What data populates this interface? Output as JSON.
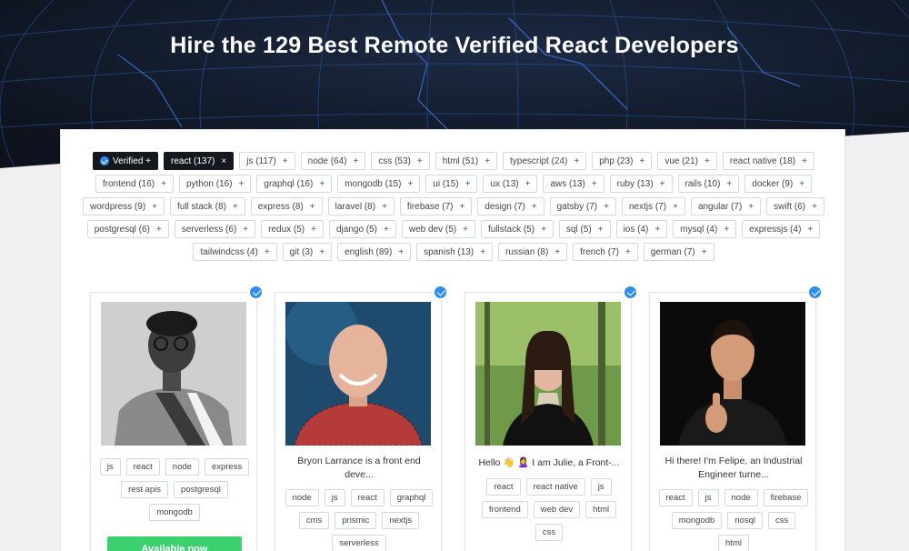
{
  "hero": {
    "title": "Hire the 129 Best Remote Verified React Developers"
  },
  "filters": {
    "verified_label": "Verified +",
    "active_label": "react (137)",
    "active_remove": "×",
    "tag_add_symbol": "+",
    "tags": [
      "js (117)",
      "node (64)",
      "css (53)",
      "html (51)",
      "typescript (24)",
      "php (23)",
      "vue (21)",
      "react native (18)",
      "frontend (16)",
      "python (16)",
      "graphql (16)",
      "mongodb (15)",
      "ui (15)",
      "ux (13)",
      "aws (13)",
      "ruby (13)",
      "rails (10)",
      "docker (9)",
      "wordpress (9)",
      "full stack (8)",
      "express (8)",
      "laravel (8)",
      "firebase (7)",
      "design (7)",
      "gatsby (7)",
      "nextjs (7)",
      "angular (7)",
      "swift (6)",
      "postgresql (6)",
      "serverless (6)",
      "redux (5)",
      "django (5)",
      "web dev (5)",
      "fullstack (5)",
      "sql (5)",
      "ios (4)",
      "mysql (4)",
      "expressjs (4)",
      "tailwindcss (4)",
      "git (3)",
      "english (89)",
      "spanish (13)",
      "russian (8)",
      "french (7)",
      "german (7)"
    ]
  },
  "developers": [
    {
      "bio": "",
      "tags": [
        "js",
        "react",
        "node",
        "express",
        "rest apis",
        "postgresql",
        "mongodb"
      ],
      "cta": "Available now"
    },
    {
      "bio": "Bryon Larrance is a front end deve...",
      "tags": [
        "node",
        "js",
        "react",
        "graphql",
        "cms",
        "prismic",
        "nextjs",
        "serverless"
      ]
    },
    {
      "bio": "Hello 👋 🙎‍♀️ I am Julie, a Front-...",
      "tags": [
        "react",
        "react native",
        "js",
        "frontend",
        "web dev",
        "html",
        "css"
      ]
    },
    {
      "bio": "Hi there! I'm Felipe, an Industrial Engineer turne...",
      "tags": [
        "react",
        "js",
        "node",
        "firebase",
        "mongodb",
        "nosql",
        "css",
        "html"
      ]
    }
  ]
}
